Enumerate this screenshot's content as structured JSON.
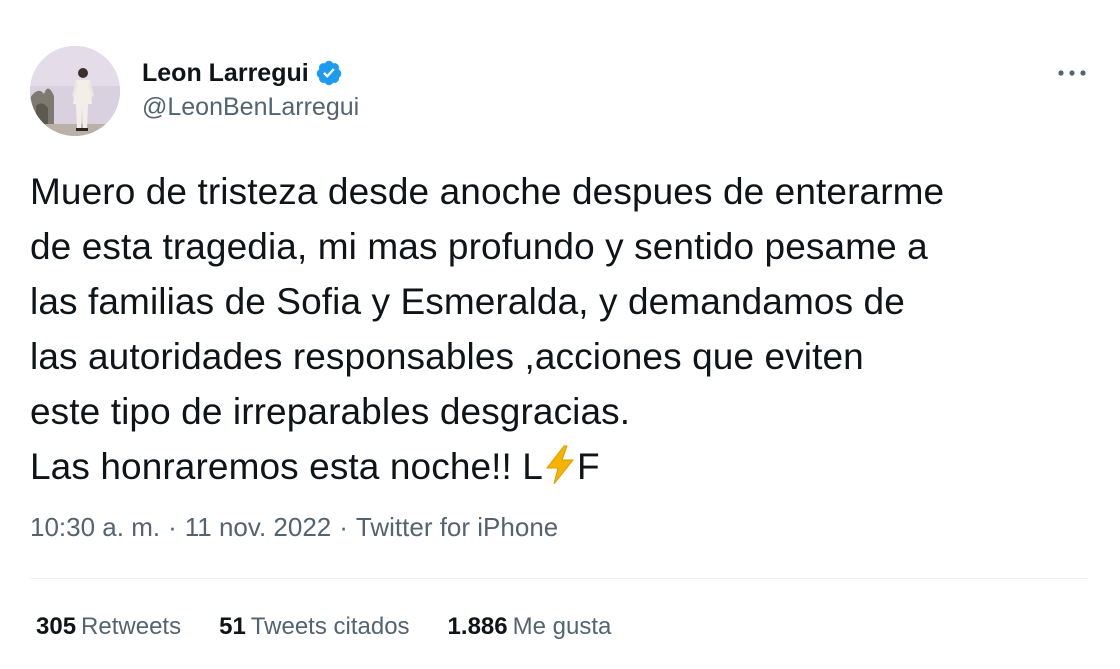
{
  "author": {
    "display_name": "Leon Larregui",
    "handle": "@LeonBenLarregui",
    "verified": true,
    "avatar_icon": "profile-photo"
  },
  "tweet": {
    "text_before_emoji": "Muero de tristeza desde anoche despues de enterarme\nde esta tragedia, mi mas profundo y sentido pesame a\nlas familias de Sofia y Esmeralda, y demandamos de\nlas autoridades  responsables ,acciones que eviten\neste tipo de irreparables desgracias.\nLas honraremos esta noche!!  L",
    "emoji": "⚡",
    "text_after_emoji": "F"
  },
  "meta": {
    "time": "10:30 a. m.",
    "separator": "·",
    "date": "11 nov. 2022",
    "source": "Twitter for iPhone"
  },
  "stats": {
    "retweets_count": "305",
    "retweets_label": "Retweets",
    "quotes_count": "51",
    "quotes_label": "Tweets citados",
    "likes_count": "1.886",
    "likes_label": "Me gusta"
  },
  "colors": {
    "text": "#0f1419",
    "secondary": "#536471",
    "verified": "#1d9bf0",
    "divider": "#eff3f4",
    "bolt": "#f4b400"
  }
}
